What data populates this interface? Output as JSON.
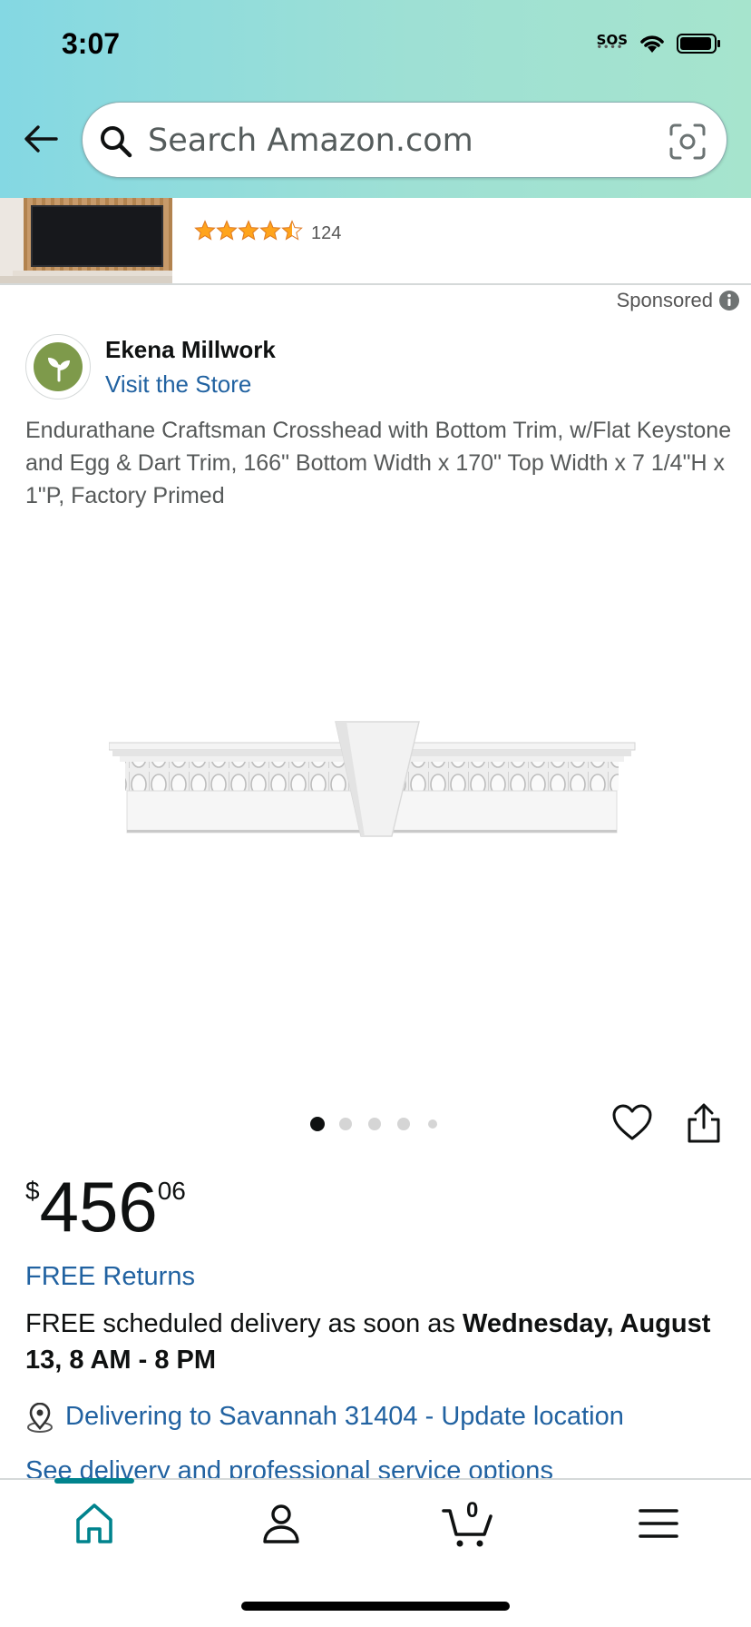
{
  "status_bar": {
    "time": "3:07",
    "sos": "SOS"
  },
  "search": {
    "placeholder": "Search Amazon.com"
  },
  "ad": {
    "rating": 4.5,
    "rating_count": "124"
  },
  "sponsored_label": "Sponsored",
  "brand": {
    "name": "Ekena Millwork",
    "visit_store": "Visit the Store"
  },
  "product": {
    "title": "Endurathane Craftsman Crosshead with Bottom Trim, w/Flat Keystone and Egg & Dart Trim, 166\" Bottom Width x 170\" Top Width x 7 1/4\"H x 1\"P, Factory Primed",
    "image_carousel": {
      "count": 5,
      "active_index": 0
    }
  },
  "price": {
    "symbol": "$",
    "whole": "456",
    "fraction": "06"
  },
  "free_returns": "FREE Returns",
  "delivery": {
    "prefix": "FREE scheduled delivery as soon as ",
    "date": "Wednesday, August 13, 8 AM - 8 PM",
    "location": "Delivering to Savannah 31404 - Update location",
    "service_options": "See delivery and professional service options"
  },
  "tabbar": {
    "cart_count": "0",
    "tabs": [
      "home-icon",
      "account-icon",
      "cart-icon",
      "menu-icon"
    ]
  },
  "colors": {
    "link": "#2162a1",
    "active_tab": "#00838d",
    "star": "#ffa41c"
  }
}
